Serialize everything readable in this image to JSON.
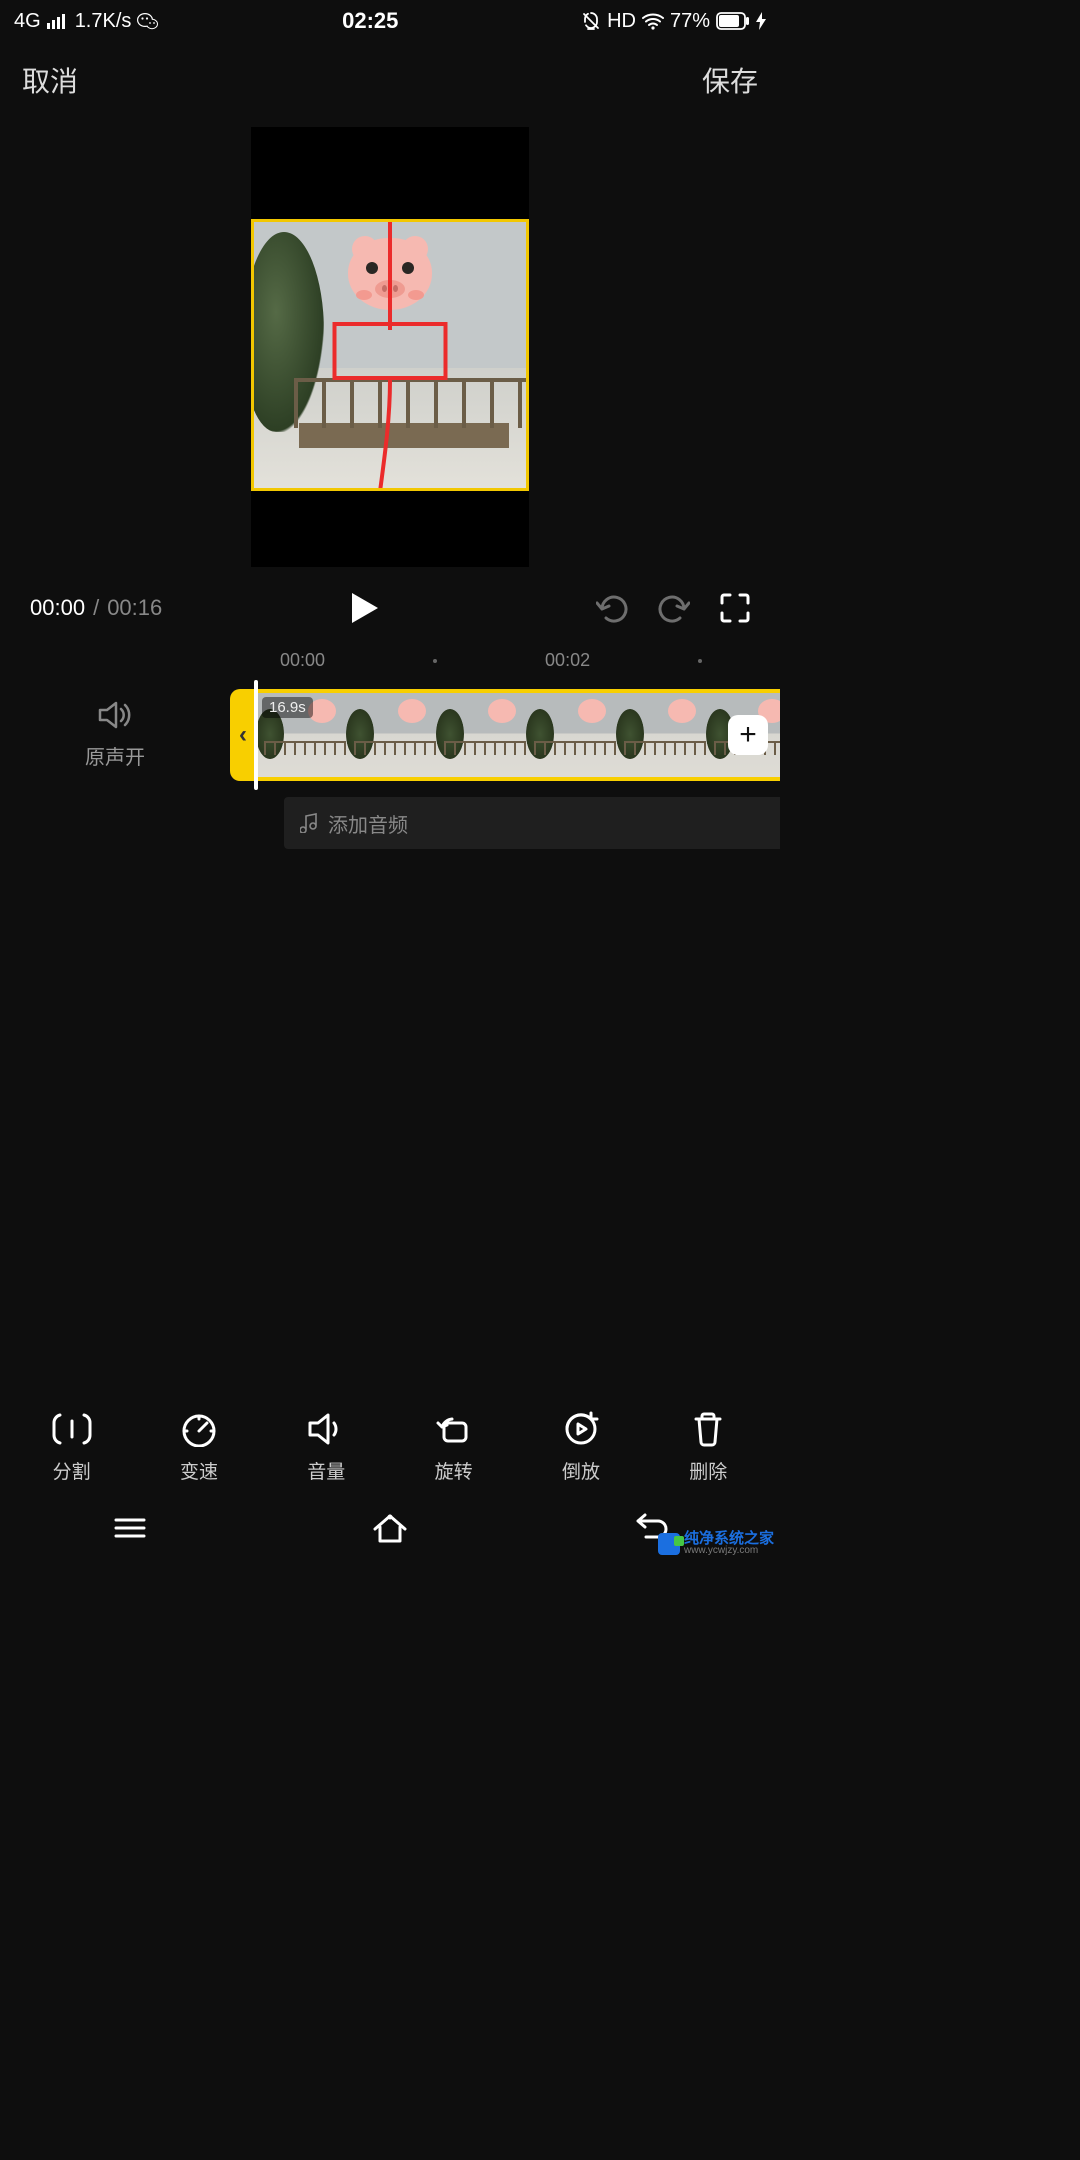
{
  "status": {
    "network": "4G",
    "speed": "1.7K/s",
    "time": "02:25",
    "hd": "HD",
    "battery": "77%"
  },
  "header": {
    "cancel": "取消",
    "save": "保存"
  },
  "playback": {
    "current": "00:00",
    "separator": "/",
    "total": "00:16"
  },
  "ruler": {
    "t0": "00:00",
    "t1": "00:02"
  },
  "timeline": {
    "sound_label": "原声开",
    "clip_duration": "16.9s",
    "handle_glyph": "‹",
    "add_glyph": "+"
  },
  "audio": {
    "add_label": "添加音频"
  },
  "tools": {
    "split": "分割",
    "speed": "变速",
    "volume": "音量",
    "rotate": "旋转",
    "reverse": "倒放",
    "delete": "删除"
  },
  "watermark": {
    "cn": "纯净系统之家",
    "url": "www.ycwjzy.com"
  }
}
